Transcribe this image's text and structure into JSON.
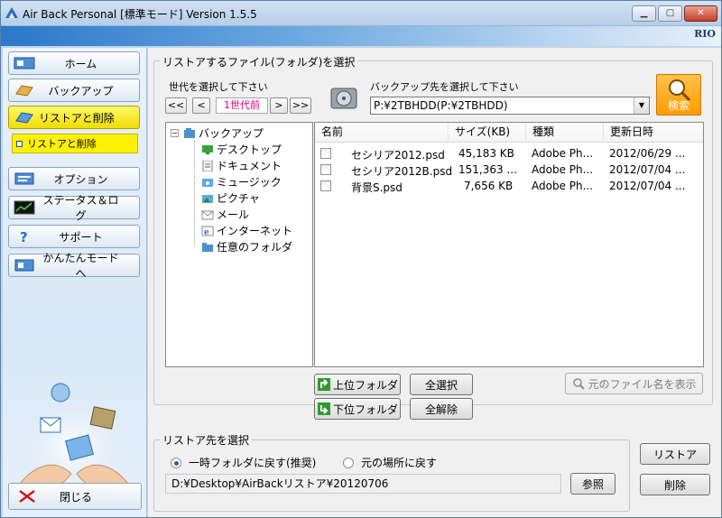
{
  "window": {
    "title": "Air Back Personal [標準モード] Version 1.5.5",
    "logo": "RIO"
  },
  "titlebar_buttons": {
    "min": "▁",
    "max": "▢",
    "close": "✕"
  },
  "sidebar": {
    "home": "ホーム",
    "backup": "バックアップ",
    "restore": "リストアと削除",
    "restore_sub": "リストアと削除",
    "options": "オプション",
    "status": "ステータス＆ログ",
    "support": "サポート",
    "easy": "かんたんモードへ",
    "close": "閉じる"
  },
  "main": {
    "select_group_title": "リストアするファイル(フォルダ)を選択",
    "generation_label": "世代を選択して下さい",
    "nav": {
      "first": "<<",
      "prev": "<",
      "next": ">",
      "last": ">>"
    },
    "generation_value": "1世代前",
    "dest_label": "バックアップ先を選択して下さい",
    "dest_value": "P:¥2TBHDD(P:¥2TBHDD)",
    "search_label": "検索",
    "tree": {
      "root": "バックアップ",
      "items": [
        "デスクトップ",
        "ドキュメント",
        "ミュージック",
        "ピクチャ",
        "メール",
        "インターネット",
        "任意のフォルダ"
      ]
    },
    "columns": {
      "name": "名前",
      "size": "サイズ(KB)",
      "type": "種類",
      "date": "更新日時"
    },
    "files": [
      {
        "name": "セシリア2012.psd",
        "size": "45,183 KB",
        "type": "Adobe Ph...",
        "date": "2012/06/29 ..."
      },
      {
        "name": "セシリア2012B.psd",
        "size": "151,363 ...",
        "type": "Adobe Ph...",
        "date": "2012/07/04 ..."
      },
      {
        "name": "背景S.psd",
        "size": "7,656 KB",
        "type": "Adobe Ph...",
        "date": "2012/07/04 ..."
      }
    ],
    "buttons": {
      "up_folder": "上位フォルダ",
      "down_folder": "下位フォルダ",
      "select_all": "全選択",
      "deselect_all": "全解除",
      "show_original": "元のファイル名を表示"
    },
    "restore_group_title": "リストア先を選択",
    "radio_temp": "一時フォルダに戻す(推奨)",
    "radio_original": "元の場所に戻す",
    "restore_path": "D:¥Desktop¥AirBackリストア¥20120706",
    "browse": "参照",
    "restore_btn": "リストア",
    "delete_btn": "削除"
  },
  "colors": {
    "accent_yellow": "#fff200",
    "generation_text": "#e6007e",
    "search_orange": "#ff9c00"
  }
}
